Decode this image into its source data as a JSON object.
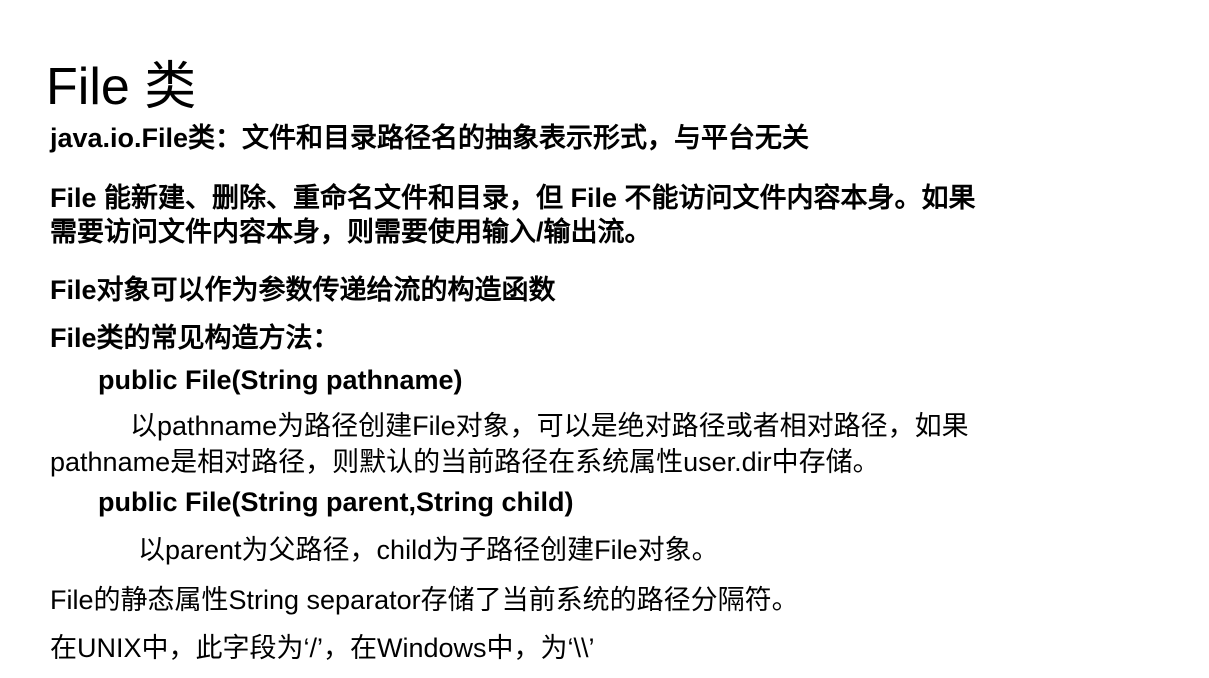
{
  "title": "File 类",
  "lines": {
    "line1": "java.io.File类：文件和目录路径名的抽象表示形式，与平台无关",
    "line2": "File 能新建、删除、重命名文件和目录，但 File 不能访问文件内容本身。如果",
    "line3": "需要访问文件内容本身，则需要使用输入/输出流。",
    "line4": "File对象可以作为参数传递给流的构造函数",
    "line5": "File类的常见构造方法：",
    "line6": "public File(String pathname)",
    "line7": "以pathname为路径创建File对象，可以是绝对路径或者相对路径，如果",
    "line8": "pathname是相对路径，则默认的当前路径在系统属性user.dir中存储。",
    "line9": "public File(String parent,String child)",
    "line10": "以parent为父路径，child为子路径创建File对象。",
    "line11": "File的静态属性String separator存储了当前系统的路径分隔符。",
    "line12": "在UNIX中，此字段为‘/’，在Windows中，为‘\\\\’"
  }
}
